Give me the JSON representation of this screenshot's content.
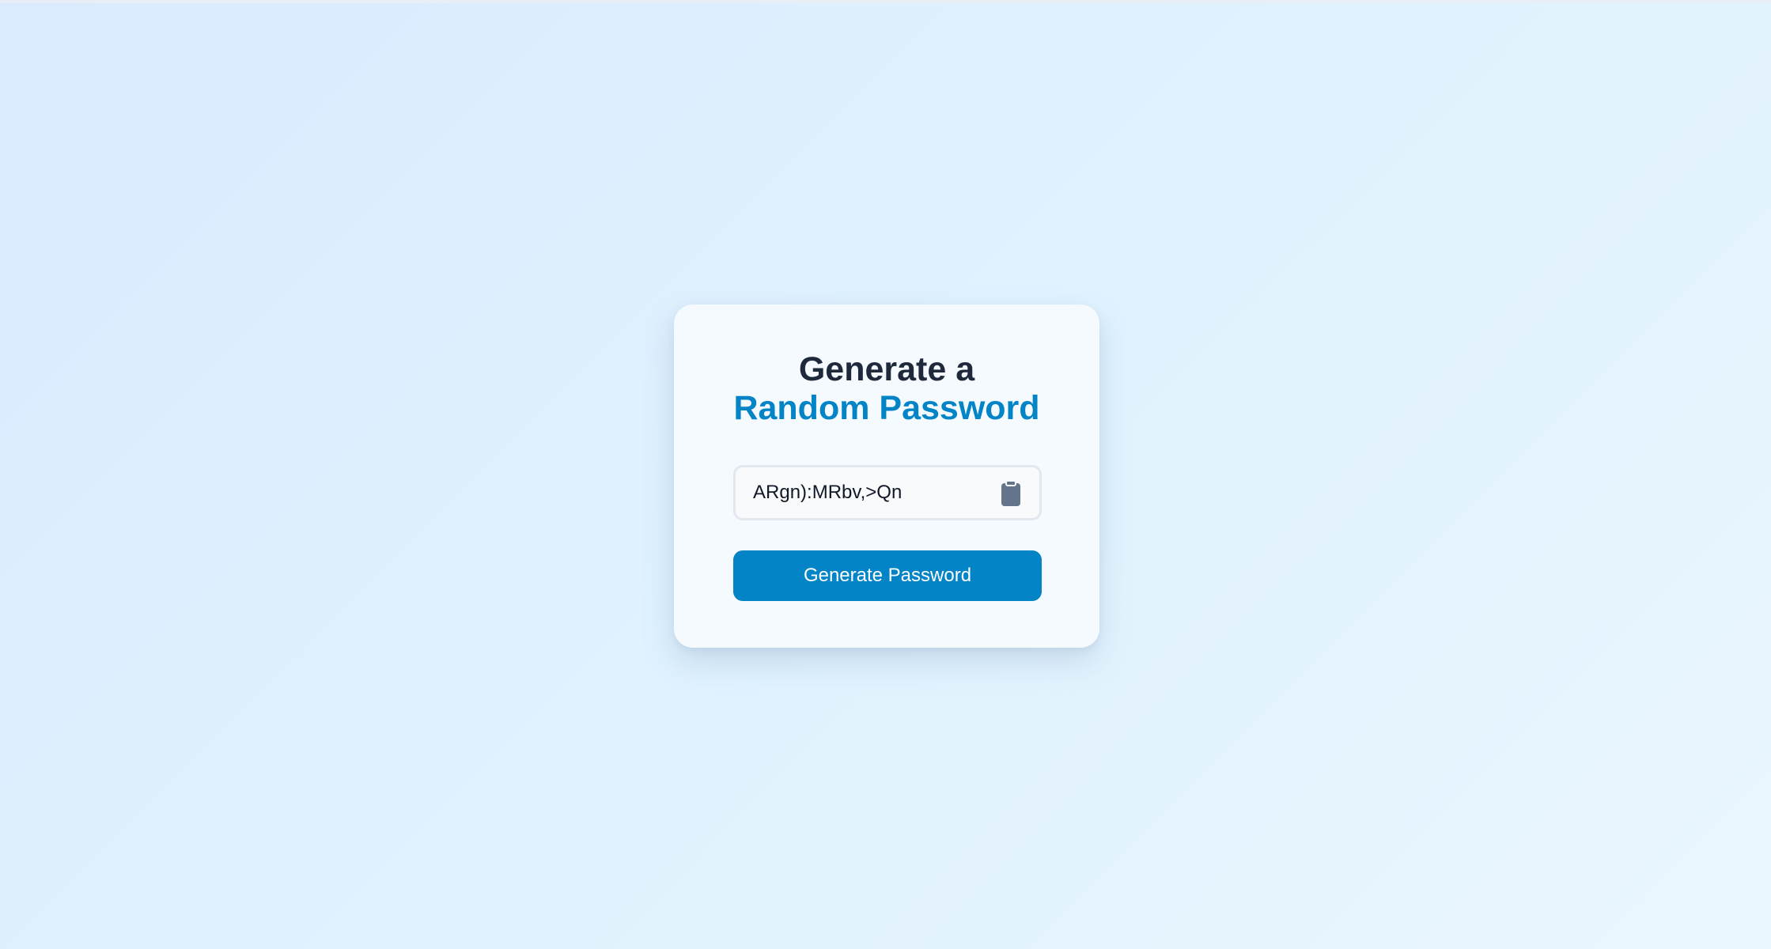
{
  "heading": {
    "line1": "Generate a",
    "line2": "Random Password"
  },
  "password": {
    "value": "ARgn):MRbv,>Qn"
  },
  "copy_button": {
    "icon": "clipboard-icon"
  },
  "generate_button": {
    "label": "Generate Password"
  },
  "colors": {
    "accent": "#0284c7",
    "heading_dark": "#1e293b",
    "icon_gray": "#64748b"
  }
}
